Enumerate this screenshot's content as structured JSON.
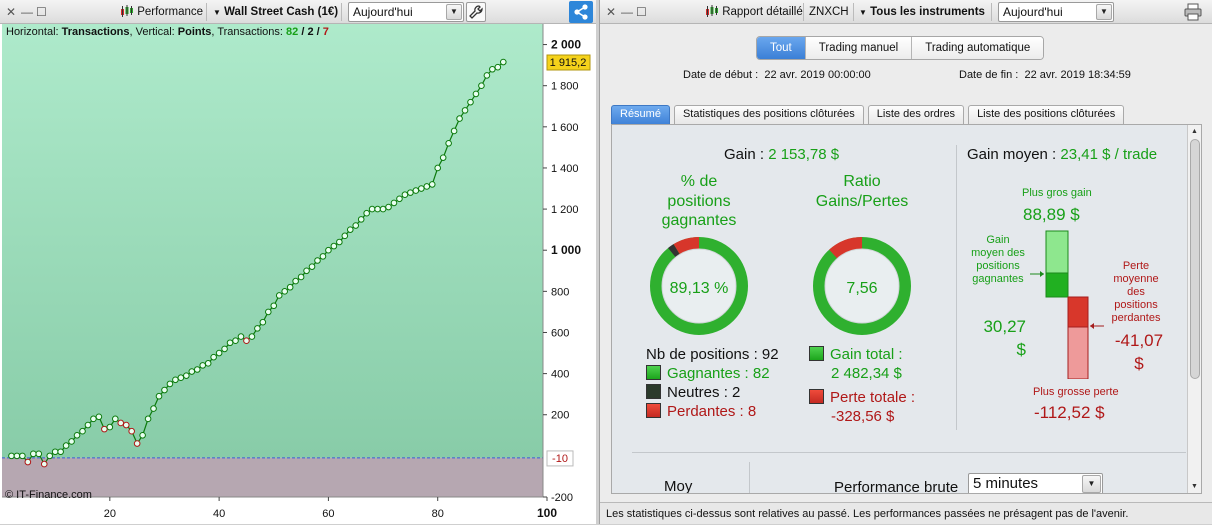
{
  "left_toolbar": {
    "controls": [
      "✕",
      "—",
      "☐"
    ],
    "performance_label": "Performance",
    "instrument_label": "Wall Street Cash (1€)",
    "period_value": "Aujourd'hui"
  },
  "chart_header": {
    "horizontal_prefix": "Horizontal: ",
    "horizontal_value": "Transactions",
    "vertical_prefix": ", Vertical: ",
    "vertical_value": "Points",
    "transactions_prefix": ", Transactions: ",
    "win_count": "82",
    "slash1": " / ",
    "neutral_count": "2",
    "slash2": " / ",
    "loss_count": "7"
  },
  "copyright": "© IT-Finance.com",
  "chart_data": {
    "type": "line",
    "xlim": [
      1,
      100
    ],
    "ylim": [
      -200,
      2100
    ],
    "x_ticks": [
      "20",
      "40",
      "60",
      "80",
      "100"
    ],
    "y_ticks": [
      "2 000",
      "1 800",
      "1 600",
      "1 400",
      "1 200",
      "1 000",
      "800",
      "600",
      "400",
      "200",
      "-200"
    ],
    "current_value_label": "1 915,2",
    "zero_label": "-10",
    "gain_area_color": "#9fe3c4",
    "loss_area_color": "#b6a7b1",
    "line_color": "#0c7a0c",
    "loss_line_color": "#b01818",
    "series": [
      {
        "values": [
          0,
          0,
          0,
          -30,
          10,
          10,
          -40,
          0,
          20,
          20,
          50,
          70,
          100,
          120,
          150,
          180,
          190,
          130,
          140,
          180,
          160,
          150,
          120,
          60,
          100,
          180,
          230,
          290,
          320,
          350,
          370,
          380,
          390,
          410,
          420,
          440,
          450,
          480,
          500,
          520,
          550,
          560,
          580,
          560,
          580,
          620,
          650,
          700,
          730,
          780,
          800,
          820,
          850,
          870,
          900,
          920,
          950,
          970,
          1000,
          1020,
          1040,
          1070,
          1100,
          1120,
          1150,
          1180,
          1200,
          1200,
          1200,
          1210,
          1230,
          1250,
          1270,
          1280,
          1290,
          1300,
          1310,
          1320,
          1400,
          1450,
          1520,
          1580,
          1640,
          1680,
          1720,
          1760,
          1800,
          1850,
          1880,
          1890,
          1915
        ]
      }
    ]
  },
  "right_toolbar": {
    "controls": [
      "✕",
      "—",
      "☐"
    ],
    "report_label": "Rapport détaillé",
    "symbol_label": "ZNXCH",
    "instruments_label": "Tous les instruments",
    "period_value": "Aujourd'hui"
  },
  "segments": [
    "Tout",
    "Trading manuel",
    "Trading automatique"
  ],
  "dates": {
    "start_label": "Date de début :",
    "start_value": "22 avr. 2019 00:00:00",
    "end_label": "Date de fin :",
    "end_value": "22 avr. 2019 18:34:59"
  },
  "tabs": [
    "Résumé",
    "Statistiques des positions clôturées",
    "Liste des ordres",
    "Liste des positions clôturées"
  ],
  "summary": {
    "gain_label": "Gain : ",
    "gain_value": "2 153,78 $",
    "pct_title_1": "% de",
    "pct_title_2": "positions",
    "pct_title_3": "gagnantes",
    "pct_value": "89,13 %",
    "pct_fraction": 0.8913,
    "ratio_title_1": "Ratio",
    "ratio_title_2": "Gains/Pertes",
    "ratio_value": "7,56",
    "nb_positions": "Nb de positions : 92",
    "gagnantes": "Gagnantes : 82",
    "neutres": "Neutres : 2",
    "perdantes": "Perdantes : 8",
    "gain_total_label": "Gain total :",
    "gain_total_value": "2 482,34 $",
    "perte_totale_label": "Perte totale :",
    "perte_totale_value": "-328,56 $",
    "gain_moyen_label": "Gain moyen : ",
    "gain_moyen_value": "23,41 $ / trade",
    "plus_gros_gain_label": "Plus gros gain",
    "plus_gros_gain_value": "88,89 $",
    "gain_moyen_positions_1": "Gain",
    "gain_moyen_positions_2": "moyen des",
    "gain_moyen_positions_3": "positions",
    "gain_moyen_positions_4": "gagnantes",
    "avg_gain_value": "30,27",
    "avg_gain_unit": "$",
    "perte_moyenne_1": "Perte",
    "perte_moyenne_2": "moyenne",
    "perte_moyenne_3": "des",
    "perte_moyenne_4": "positions",
    "perte_moyenne_5": "perdantes",
    "avg_loss_value": "-41,07",
    "avg_loss_unit": "$",
    "plus_grosse_perte_label": "Plus grosse perte",
    "plus_grosse_perte_value": "-112,52 $",
    "moy_label": "Moy",
    "perf_brute_label": "Performance brute",
    "perf_brute_select": "5 minutes"
  },
  "status_text": "Les statistiques ci-dessus sont relatives au passé. Les performances passées ne présagent pas de l'avenir.",
  "colors": {
    "accent": "#3b7fd6",
    "gain_green": "#18a018",
    "loss_red": "#b01818"
  }
}
